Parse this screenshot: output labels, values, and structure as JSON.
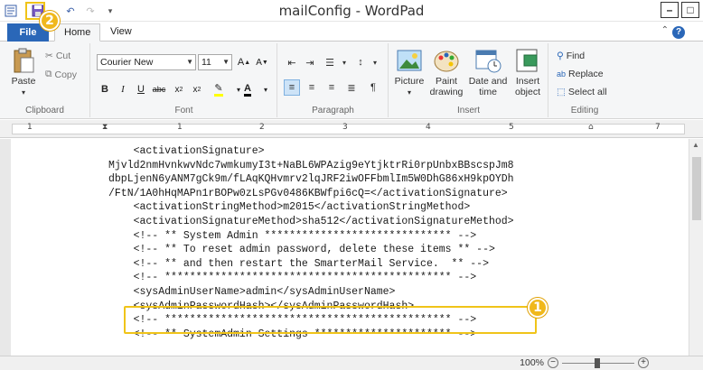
{
  "window": {
    "title": "mailConfig - WordPad"
  },
  "tabs": {
    "file": "File",
    "home": "Home",
    "view": "View"
  },
  "ribbon": {
    "clipboard": {
      "label": "Clipboard",
      "paste": "Paste",
      "cut": "Cut",
      "copy": "Copy"
    },
    "font": {
      "label": "Font",
      "family": "Courier New",
      "size": "11"
    },
    "paragraph": {
      "label": "Paragraph"
    },
    "insert": {
      "label": "Insert",
      "picture": "Picture",
      "paint1": "Paint",
      "paint2": "drawing",
      "datetime1": "Date and",
      "datetime2": "time",
      "object1": "Insert",
      "object2": "object"
    },
    "editing": {
      "label": "Editing",
      "find": "Find",
      "replace": "Replace",
      "selectall": "Select all"
    }
  },
  "ruler": {
    "numbers": [
      "1",
      "1",
      "2",
      "3",
      "4",
      "5",
      "6",
      "7"
    ]
  },
  "document": {
    "lines": [
      "    <activationSignature>",
      "Mjvld2nmHvnkwvNdc7wmkumyI3t+NaBL6WPAzig9eYtjktrRi0rpUnbxBBscspJm8",
      "dbpLjenN6yANM7gCk9m/fLAqKQHvmrv2lqJRF2iwOFFbmlIm5W0DhG86xH9kpOYDh",
      "/FtN/1A0hHqMAPn1rBOPw0zLsPGv0486KBWfpi6cQ=</activationSignature>",
      "    <activationStringMethod>m2015</activationStringMethod>",
      "    <activationSignatureMethod>sha512</activationSignatureMethod>",
      "    <!-- ** System Admin ****************************** -->",
      "    <!-- ** To reset admin password, delete these items ** -->",
      "    <!-- ** and then restart the SmarterMail Service.  ** -->",
      "    <!-- ********************************************** -->",
      "    <sysAdminUserName>admin</sysAdminUserName>",
      "    <sysAdminPasswordHash></sysAdminPasswordHash>",
      "    <!-- ********************************************** -->",
      "    <!-- ** SystemAdmin Settings ********************** -->"
    ]
  },
  "status": {
    "zoom": "100%"
  },
  "annotations": {
    "badge1": "1",
    "badge2": "2"
  },
  "colors": {
    "accent": "#2a67b8",
    "highlight": "#f0c419",
    "badge": "#f0b81c"
  }
}
